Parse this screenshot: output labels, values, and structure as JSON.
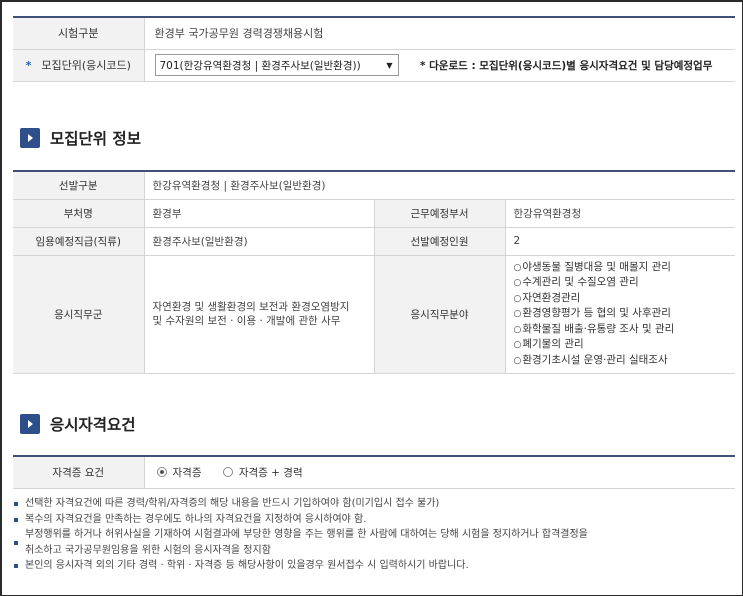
{
  "top": {
    "exam_label": "시험구분",
    "exam_value": "환경부 국가공무원 경력경쟁채용시험",
    "unit_star": "*",
    "unit_label": "모집단위(응시코드)",
    "unit_selected": "701(한강유역환경청 | 환경주사보(일반환경))",
    "download_note": "* 다운로드 : 모집단위(응시코드)별 응시자격요건 및 담당예정업무"
  },
  "section1": {
    "title": "모집단위 정보"
  },
  "info": {
    "selection_label": "선발구분",
    "selection_value": "한강유역환경청 | 환경주사보(일반환경)",
    "ministry_label": "부처명",
    "ministry_value": "환경부",
    "dept_label": "근무예정부서",
    "dept_value": "한강유역환경청",
    "rank_label": "임용예정직급(직류)",
    "rank_value": "환경주사보(일반환경)",
    "count_label": "선발예정인원",
    "count_value": "2",
    "jobgroup_label": "응시직무군",
    "jobgroup_value": "자연환경 및 생활환경의 보전과 환경오염방지 및 수자원의 보전 · 이용 · 개발에 관한 사무",
    "duty_label": "응시직무분야",
    "duties": [
      "야생동물 질병대응 및 매몰지 관리",
      "수계관리 및 수질오염 관리",
      "자연환경관리",
      "환경영향평가 등 협의 및 사후관리",
      "화학물질 배출·유통량 조사 및 관리",
      "폐기물의 관리",
      "환경기초시설 운영·관리 실태조사"
    ]
  },
  "section2": {
    "title": "응시자격요건"
  },
  "qual": {
    "label": "자격증 요건",
    "option1": "자격증",
    "option2": "자격증 + 경력",
    "notes": [
      "선택한 자격요건에 따른 경력/학위/자격증의 해당 내용을 반드시 기입하여야 함(미기입시 접수 불가)",
      "복수의 자격요건을 만족하는 경우에도 하나의 자격요건을 지정하여 응시하여야 함.",
      "부정행위를 하거나 허위사실을 기재하여 시험결과에 부당한 영향을 주는 행위를 한 사람에 대하여는 당해 시험을 정지하거나 합격결정을",
      "취소하고 국가공무원임용을 위한 시험의 응시자격을 정지함",
      "본인의 응시자격 외의 기타 경력 · 학위 · 자격증 등 해당사항이 있을경우 원서접수 시 입력하시기 바랍니다."
    ]
  }
}
